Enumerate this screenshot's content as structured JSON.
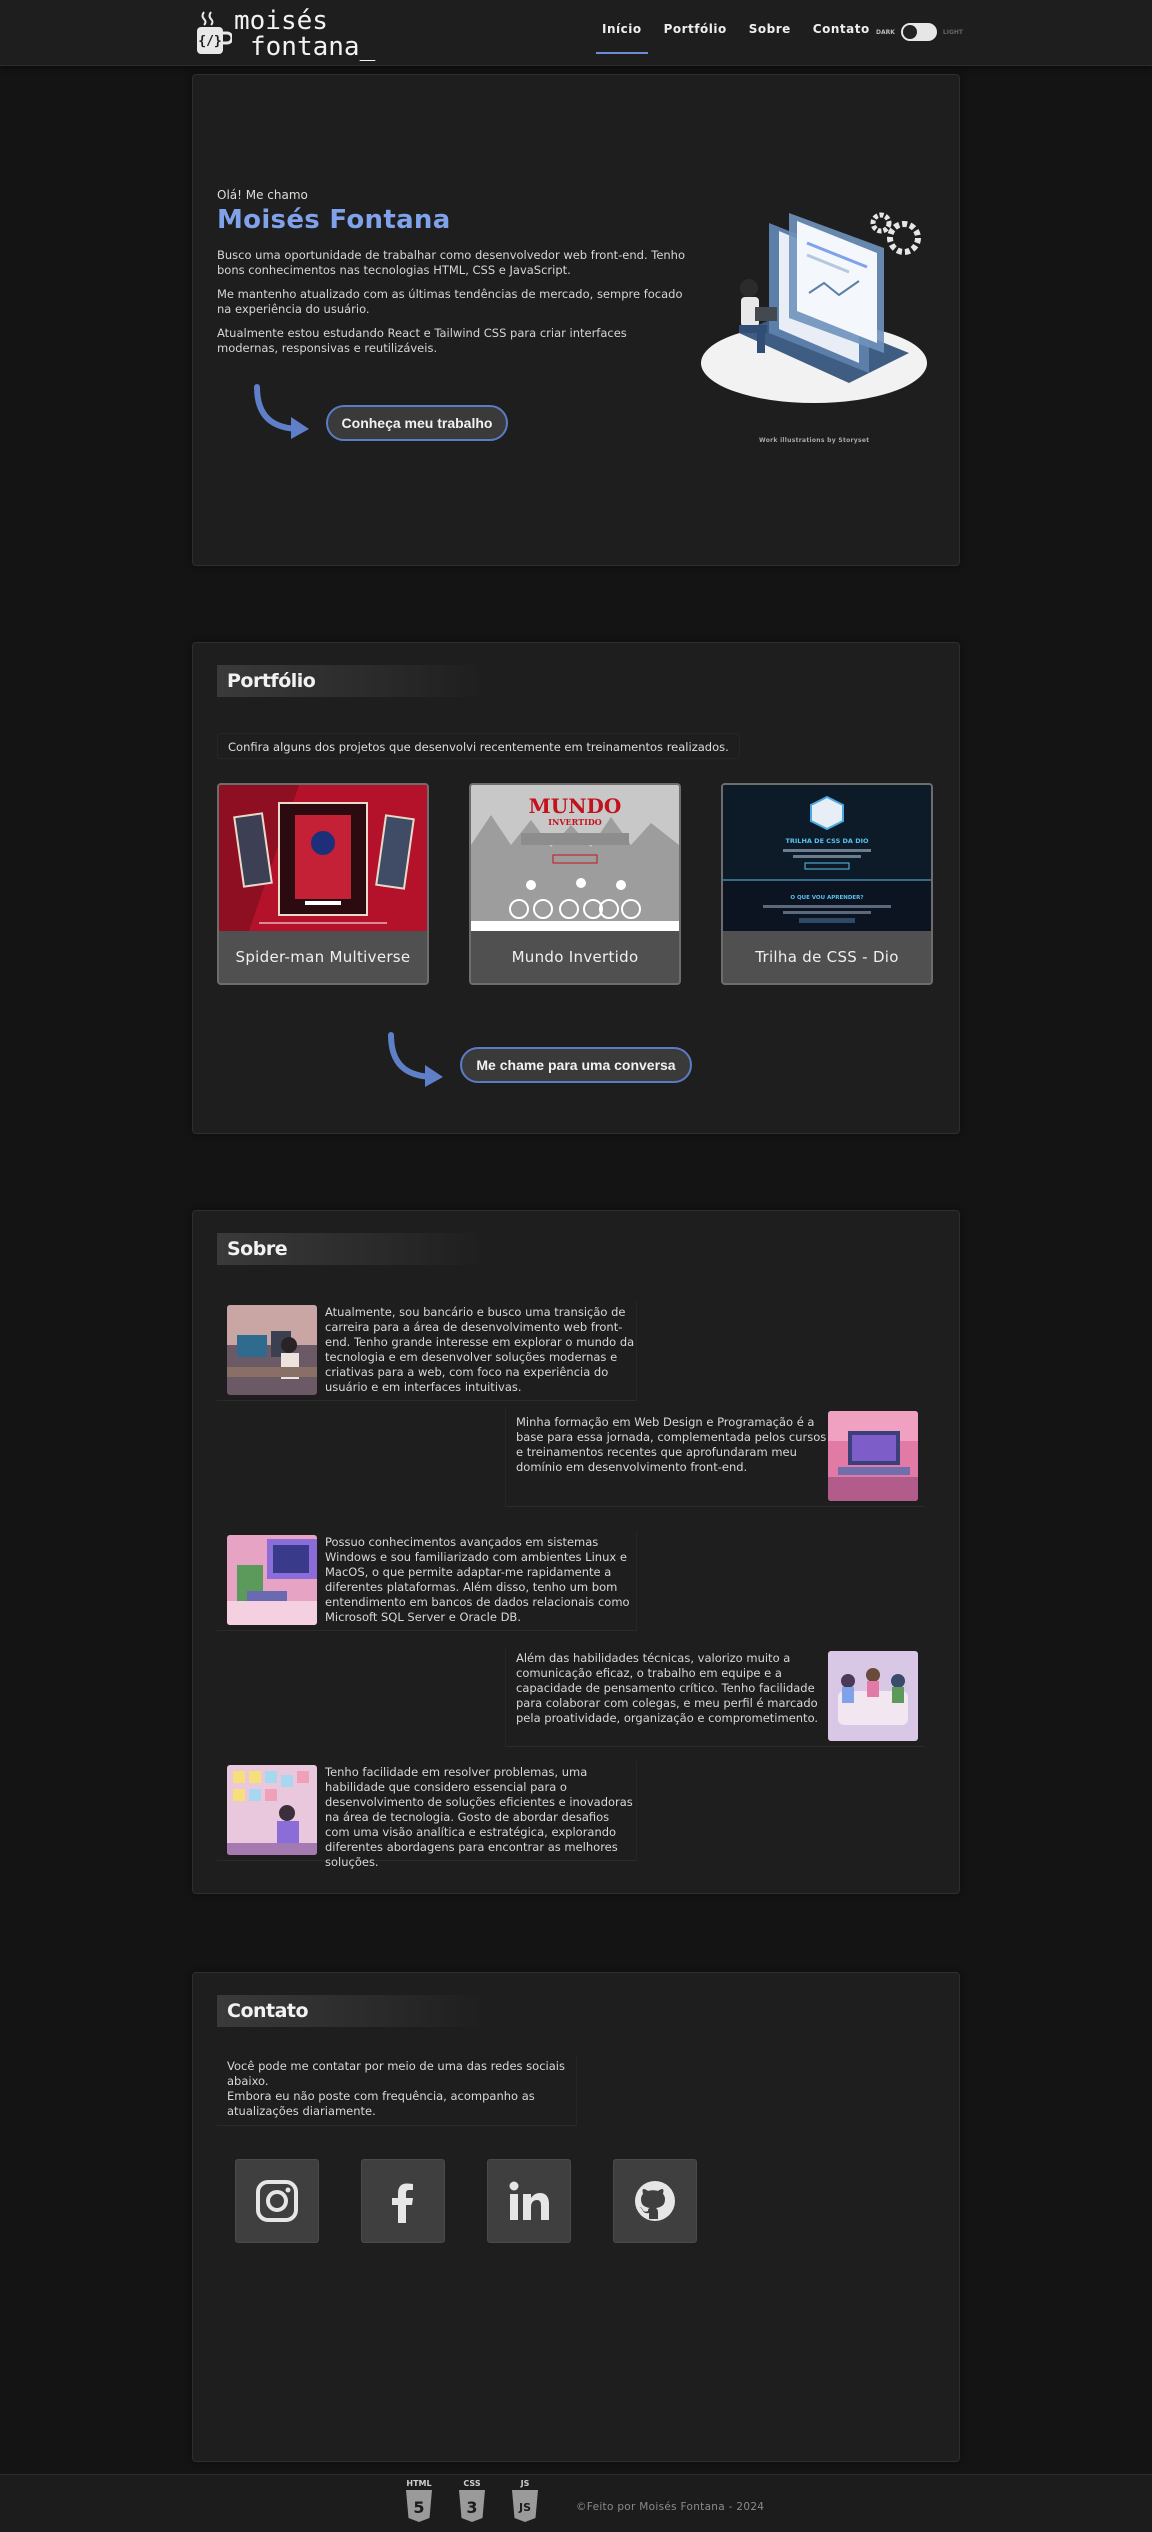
{
  "header": {
    "logo_line1": "moisés",
    "logo_line2": "fontana_",
    "nav": [
      "Início",
      "Portfólio",
      "Sobre",
      "Contato"
    ],
    "theme_dark": "DARK",
    "theme_light": "LIGHT"
  },
  "hero": {
    "greeting": "Olá! Me chamo",
    "name": "Moisés Fontana",
    "p1": "Busco uma oportunidade de trabalhar como desenvolvedor web front-end. Tenho bons conhecimentos nas tecnologias HTML, CSS e JavaScript.",
    "p2": "Me mantenho atualizado com as últimas tendências de mercado, sempre focado na experiência do usuário.",
    "p3": "Atualmente estou estudando React e Tailwind CSS para criar interfaces modernas, responsivas e reutilizáveis.",
    "cta": "Conheça meu trabalho",
    "credit": "Work illustrations by Storyset"
  },
  "portfolio": {
    "title": "Portfólio",
    "intro": "Confira alguns dos projetos que desenvolvi recentemente em treinamentos realizados.",
    "projects": [
      "Spider-man Multiverse",
      "Mundo Invertido",
      "Trilha de CSS - Dio"
    ],
    "mundo_logo1": "MUNDO",
    "mundo_logo2": "INVERTIDO",
    "dio_heading": "TRILHA DE CSS DA DIO",
    "dio_sub": "O QUE VOU APRENDER?",
    "cta": "Me chame para uma conversa"
  },
  "sobre": {
    "title": "Sobre",
    "paragraphs": [
      "Atualmente, sou bancário e busco uma transição de carreira para a área de desenvolvimento web front-end. Tenho grande interesse em explorar o mundo da tecnologia e em desenvolver soluções modernas e criativas para a web, com foco na experiência do usuário e em interfaces intuitivas.",
      "Minha formação em Web Design e Programação é a base para essa jornada, complementada pelos cursos e treinamentos recentes que aprofundaram meu domínio em desenvolvimento front-end.",
      "Possuo conhecimentos avançados em sistemas Windows e sou familiarizado com ambientes Linux e MacOS, o que permite adaptar-me rapidamente a diferentes plataformas. Além disso, tenho um bom entendimento em bancos de dados relacionais como Microsoft SQL Server e Oracle DB.",
      "Além das habilidades técnicas, valorizo muito a comunicação eficaz, o trabalho em equipe e a capacidade de pensamento crítico. Tenho facilidade para colaborar com colegas, e meu perfil é marcado pela proatividade, organização e comprometimento.",
      "Tenho facilidade em resolver problemas, uma habilidade que considero essencial para o desenvolvimento de soluções eficientes e inovadoras na área de tecnologia. Gosto de abordar desafios com uma visão analítica e estratégica, explorando diferentes abordagens para encontrar as melhores soluções."
    ]
  },
  "contato": {
    "title": "Contato",
    "line1": "Você pode me contatar por meio de uma das redes sociais abaixo.",
    "line2": "Embora eu não poste com frequência, acompanho as atualizações diariamente."
  },
  "footer": {
    "tech": [
      "HTML",
      "CSS",
      "JS"
    ],
    "tech_numbers": [
      "5",
      "3",
      "JS"
    ],
    "text": "©Feito por Moisés Fontana - 2024"
  },
  "colors": {
    "accent": "#7fa2ea",
    "bg": "#141414",
    "panel": "#1e1e1e"
  }
}
